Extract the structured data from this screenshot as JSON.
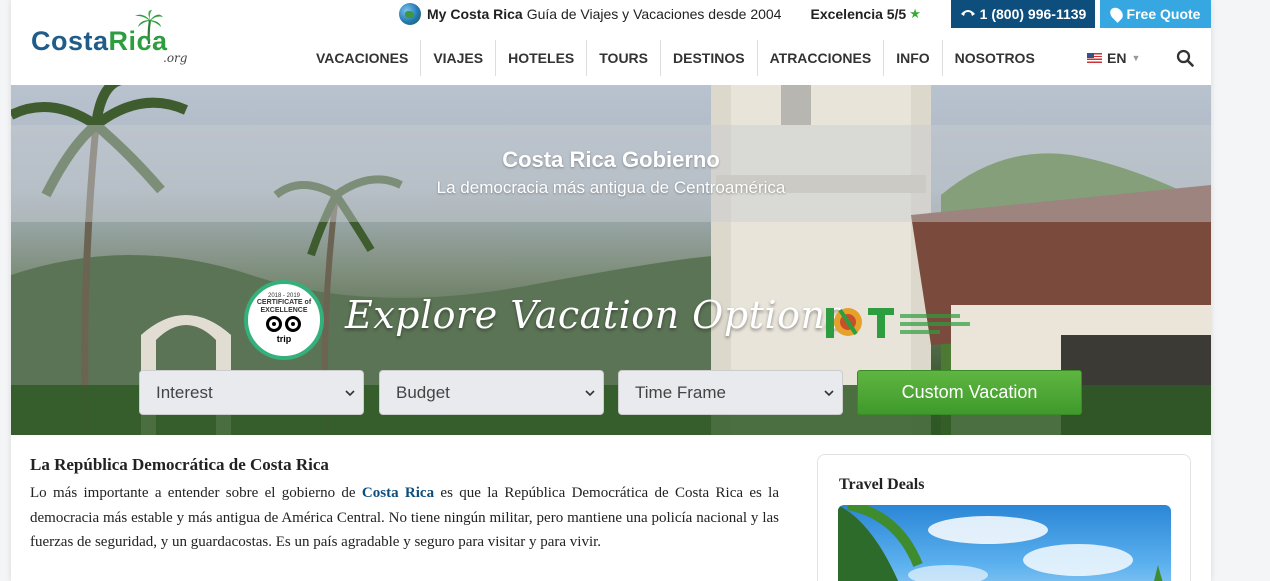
{
  "logo": {
    "part1": "Costa",
    "part2": "Rica",
    "suffix": ".org"
  },
  "topbar": {
    "brand": "My Costa Rica",
    "tagline": "Guía de Viajes y Vacaciones desde 2004",
    "excellence": "Excelencia 5/5",
    "phone": "1 (800) 996-1139",
    "quote": "Free Quote"
  },
  "nav": {
    "items": [
      "VACACIONES",
      "VIAJES",
      "HOTELES",
      "TOURS",
      "DESTINOS",
      "ATRACCIONES",
      "INFO",
      "NOSOTROS"
    ],
    "language": "EN"
  },
  "hero": {
    "title": "Costa Rica Gobierno",
    "subtitle": "La democracia más antigua de Centroamérica",
    "explore": "Explore Vacation Options",
    "badge": {
      "years": "2018 - 2019",
      "cert_line1": "CERTIFICATE of",
      "cert_line2": "EXCELLENCE",
      "brand": "trip"
    },
    "selects": [
      {
        "placeholder": "Interest"
      },
      {
        "placeholder": "Budget"
      },
      {
        "placeholder": "Time Frame"
      }
    ],
    "cta": "Custom Vacation"
  },
  "article": {
    "heading": "La República Democrática de Costa Rica",
    "text_before_link": "Lo más importante a entender sobre el gobierno de ",
    "link": "Costa Rica",
    "text_after_link": " es que la República Democrática de Costa Rica es la democracia más estable y más antigua de América Central. No tiene ningún militar, pero mantiene una policía nacional y las fuerzas de seguridad, y un guardacostas. Es un país agradable y seguro para visitar y para vivir."
  },
  "sidebar": {
    "title": "Travel Deals"
  },
  "colors": {
    "brand_blue": "#0d4e7d",
    "quote_blue": "#36a7e0",
    "cta_green": "#4fa838"
  }
}
